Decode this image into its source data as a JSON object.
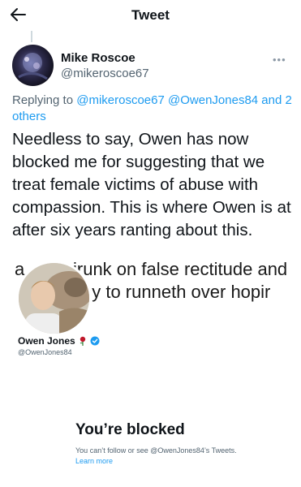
{
  "header": {
    "title": "Tweet",
    "back_icon": "arrow-left-icon"
  },
  "tweet": {
    "author_name": "Mike Roscoe",
    "author_handle": "@mikeroscoe67",
    "more_icon": "more-dots-icon",
    "replying_prefix": "Replying to",
    "replying_handle_1": "@mikeroscoe67",
    "replying_handle_2": "@OwenJones84",
    "replying_and_others": "and 2 others",
    "text": "Needless to say, Owen has now blocked me for suggesting that we treat female victims of abuse with compassion. This is where Owen is at after six years ranting about this."
  },
  "screenshot": {
    "bg_fragment": "a",
    "bg_line_1": "irunk on false rectitude and",
    "bg_line_2": "yny to runneth over hopir",
    "profile_name": "Owen Jones",
    "profile_handle": "@OwenJones84",
    "rose_icon": "rose-emoji-icon",
    "verified_icon": "verified-badge-icon",
    "blocked_title": "You’re blocked",
    "blocked_subtitle": "You can’t follow or see @OwenJones84’s Tweets.",
    "learn_more": "Learn more"
  },
  "colors": {
    "accent": "#1d9bf0",
    "text": "#0f1419",
    "secondary": "#536471",
    "rose": "#c0182a"
  }
}
